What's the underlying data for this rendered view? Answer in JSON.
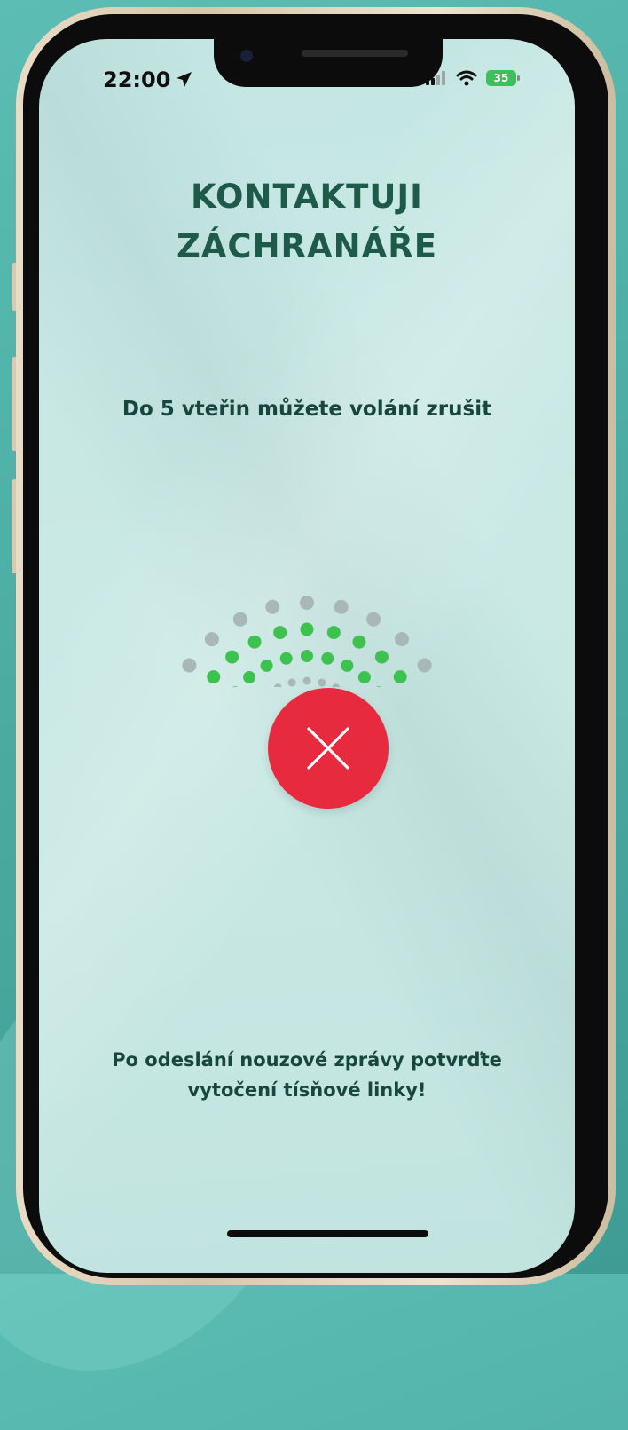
{
  "status_bar": {
    "time": "22:00",
    "battery": "35",
    "icons": [
      "location-arrow-icon",
      "signal-icon",
      "wifi-icon",
      "battery-icon"
    ]
  },
  "screen": {
    "title_line1": "KONTAKTUJI",
    "title_line2": "ZÁCHRANÁŘE",
    "subtitle": "Do 5 vteřin můžete volání zrušit",
    "cancel_icon": "close-icon",
    "footer_line1": "Po odeslání nouzové zprávy potvrďte",
    "footer_line2": "vytočení tísňové linky!"
  },
  "colors": {
    "title": "#1d5a4a",
    "text": "#17463c",
    "cancel_button": "#e72a3d",
    "signal_active": "#3ec24f",
    "signal_inactive": "#a9b8b6",
    "screen_background": "#c8e8e4",
    "outer_background": "#4fb0a7"
  }
}
